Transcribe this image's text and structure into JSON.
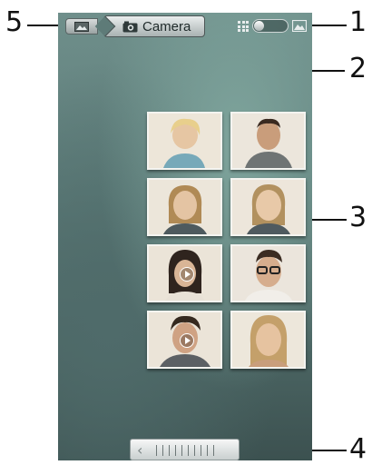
{
  "header": {
    "breadcrumb_current": "Camera",
    "home_icon": "gallery-icon",
    "camera_icon": "camera-icon",
    "view_grid_icon": "grid-view-icon",
    "view_photo_icon": "photo-view-icon"
  },
  "callouts": {
    "c1": "1",
    "c2": "2",
    "c3": "3",
    "c4": "4",
    "c5": "5"
  },
  "thumbnails": [
    {
      "kind": "photo",
      "video": false
    },
    {
      "kind": "photo",
      "video": false
    },
    {
      "kind": "photo",
      "video": false
    },
    {
      "kind": "photo",
      "video": false
    },
    {
      "kind": "video",
      "video": true
    },
    {
      "kind": "photo",
      "video": false
    },
    {
      "kind": "video",
      "video": true
    },
    {
      "kind": "photo",
      "video": false
    }
  ],
  "scrollbar": {
    "left_icon": "chevron-left-icon"
  },
  "colors": {
    "accent": "#5d7c79",
    "frame": "#f4f4f0"
  }
}
